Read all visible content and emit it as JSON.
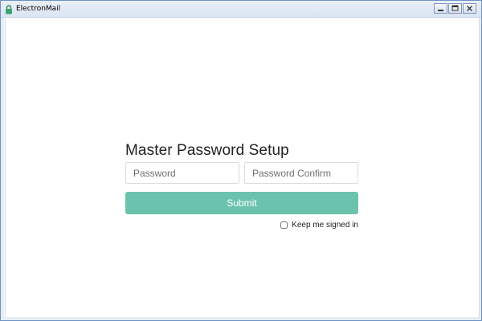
{
  "window": {
    "title": "ElectronMail",
    "app_icon": "lock-icon",
    "controls": [
      "minimize-icon",
      "maximize-icon",
      "close-icon"
    ]
  },
  "form": {
    "title": "Master Password Setup",
    "password_placeholder": "Password",
    "password_confirm_placeholder": "Password Confirm",
    "password_value": "",
    "password_confirm_value": "",
    "submit_label": "Submit",
    "keep_signed_in_label": "Keep me signed in",
    "keep_signed_in_checked": false
  },
  "colors": {
    "accent": "#6cc3ad",
    "titlebar": "#dbe5f2",
    "window_border": "#6f93c4"
  }
}
